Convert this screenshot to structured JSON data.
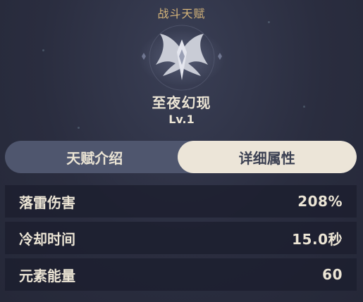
{
  "header": {
    "title": "战斗天赋"
  },
  "talent": {
    "name": "至夜幻现",
    "level": "Lv.1"
  },
  "tabs": [
    {
      "label": "天赋介绍",
      "active": false
    },
    {
      "label": "详细属性",
      "active": true
    }
  ],
  "stats": [
    {
      "label": "落雷伤害",
      "value": "208%"
    },
    {
      "label": "冷却时间",
      "value": "15.0秒"
    },
    {
      "label": "元素能量",
      "value": "60"
    }
  ],
  "colors": {
    "accent_gold": "#d6b57a",
    "active_tab_bg": "#ece5d8",
    "inactive_tab_bg": "#4f566e",
    "row_bg": "#1c1f2e"
  },
  "icons": {
    "emblem": "winged-talent-emblem-icon"
  }
}
